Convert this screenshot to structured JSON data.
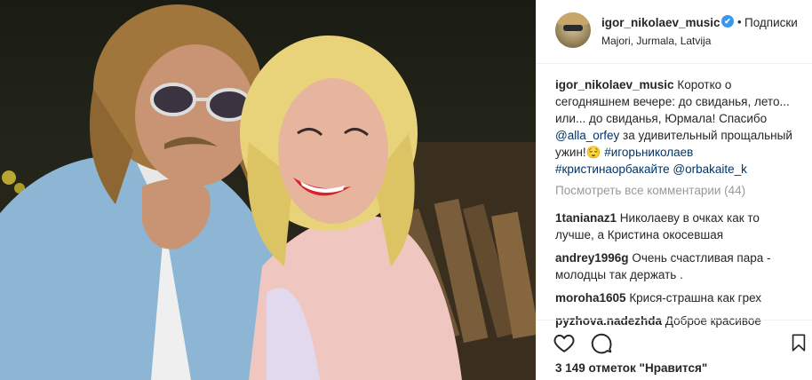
{
  "post": {
    "author": "igor_nikolaev_music",
    "verified_mark": "✔",
    "separator": "•",
    "follow_label": "Подписки",
    "location": "Majori, Jurmala, Latvija",
    "caption": {
      "user": "igor_nikolaev_music",
      "text_1": "Коротко о сегодняшнем вечере: до свиданья, лето... или... до свиданья, Юрмала! Спасибо ",
      "mention_1": "@alla_orfey",
      "text_2": " за удивительный прощальный ужин!😌 ",
      "hashtag_1": "#игорьниколаев",
      "text_3": " ",
      "hashtag_2": "#кристинаорбакайте",
      "text_4": " ",
      "mention_2": "@orbakaite_k"
    },
    "view_all_comments": "Посмотреть все комментарии (44)",
    "comments": [
      {
        "user": "1tanianaz1",
        "text": "Николаеву в очках как то лучше, а Кристина окосевшая"
      },
      {
        "user": "andrey1996g",
        "text": "Очень счастливая пара - молодцы так держать ."
      },
      {
        "user": "moroha1605",
        "text": "Крися-страшна как грех"
      },
      {
        "user": "pyzhova.nadezhda",
        "text": "Доброе красивое"
      }
    ],
    "likes_text": "3 149 отметок \"Нравится\""
  },
  "icons": {
    "like": "heart-icon",
    "comment": "comment-icon",
    "save": "bookmark-icon",
    "verified": "verified-badge-icon"
  },
  "colors": {
    "verified": "#3897f0",
    "link": "#003569",
    "muted": "#999999",
    "border": "#efefef"
  }
}
